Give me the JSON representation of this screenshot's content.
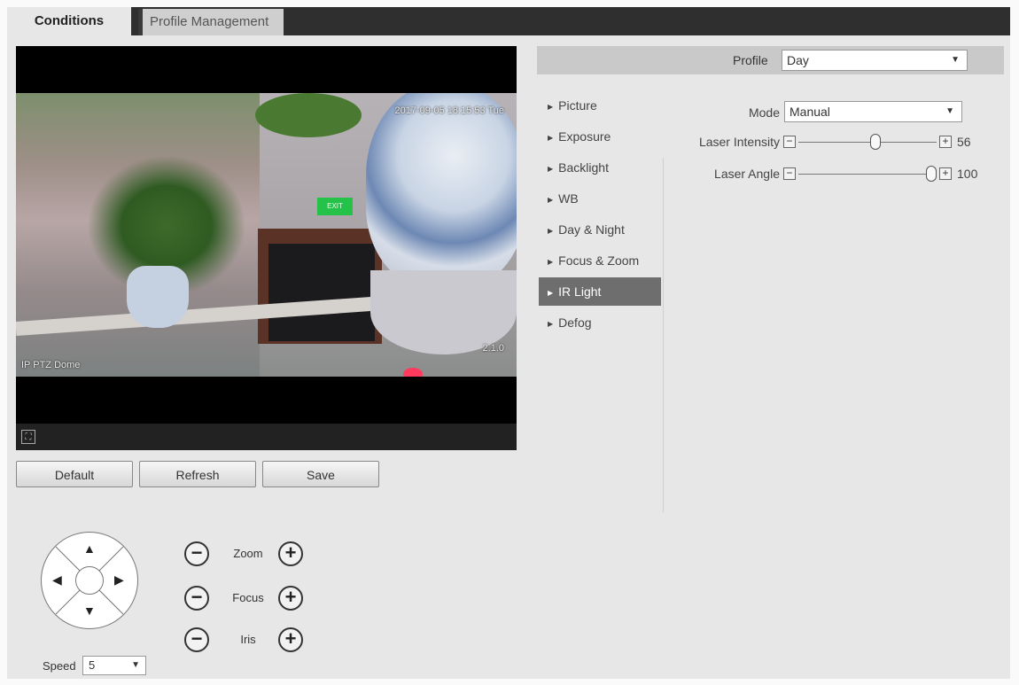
{
  "tabs": {
    "conditions": "Conditions",
    "profile_management": "Profile Management"
  },
  "video": {
    "timestamp": "2017-09-05 18:15:53 Tue",
    "channel_name": "IP PTZ Dome",
    "zoom_level": "2.1.0",
    "exit_sign": "EXIT"
  },
  "buttons": {
    "default": "Default",
    "refresh": "Refresh",
    "save": "Save"
  },
  "ptz": {
    "zoom": "Zoom",
    "focus": "Focus",
    "iris": "Iris",
    "minus": "−",
    "plus": "+",
    "speed_label": "Speed",
    "speed_value": "5"
  },
  "profile": {
    "label": "Profile",
    "value": "Day"
  },
  "menu": [
    "Picture",
    "Exposure",
    "Backlight",
    "WB",
    "Day & Night",
    "Focus & Zoom",
    "IR Light",
    "Defog"
  ],
  "menu_active": "IR Light",
  "settings": {
    "mode_label": "Mode",
    "mode_value": "Manual",
    "laser_intensity_label": "Laser Intensity",
    "laser_intensity_value": "56",
    "laser_intensity_fraction": 0.56,
    "laser_angle_label": "Laser Angle",
    "laser_angle_value": "100",
    "laser_angle_fraction": 1.0
  },
  "icons": {
    "caret": "▼",
    "menu_triangle": "▶",
    "fullscreen": "⛶",
    "up": "▲",
    "down": "▼",
    "left": "◀",
    "right": "▶"
  }
}
